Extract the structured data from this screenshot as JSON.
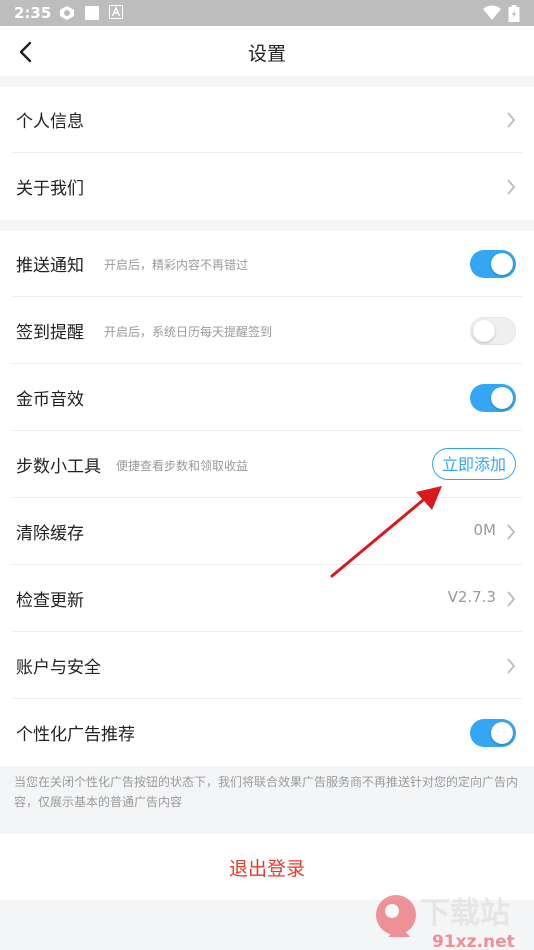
{
  "status_bar": {
    "time": "2:35"
  },
  "header": {
    "title": "设置"
  },
  "section1": [
    {
      "label": "个人信息"
    },
    {
      "label": "关于我们"
    }
  ],
  "section2": [
    {
      "label": "推送通知",
      "subtitle": "开启后，精彩内容不再错过",
      "toggle": "on"
    },
    {
      "label": "签到提醒",
      "subtitle": "开启后，系统日历每天提醒签到",
      "toggle": "off"
    },
    {
      "label": "金币音效",
      "toggle": "on"
    },
    {
      "label": "步数小工具",
      "subtitle": "便捷查看步数和领取收益",
      "button": "立即添加"
    },
    {
      "label": "清除缓存",
      "value": "0M"
    },
    {
      "label": "检查更新",
      "value": "V2.7.3"
    },
    {
      "label": "账户与安全"
    },
    {
      "label": "个性化广告推荐",
      "toggle": "on"
    }
  ],
  "note": "当您在关闭个性化广告按钮的状态下，我们将联合效果广告服务商不再推送针对您的定向广告内容，仅展示基本的普通广告内容",
  "logout_label": "退出登录",
  "watermark": {
    "text_main": "下载站",
    "text_url": "91xz.net"
  },
  "colors": {
    "accent": "#33a6f5",
    "danger": "#e53b2c",
    "annotation_arrow": "#d9191f"
  }
}
